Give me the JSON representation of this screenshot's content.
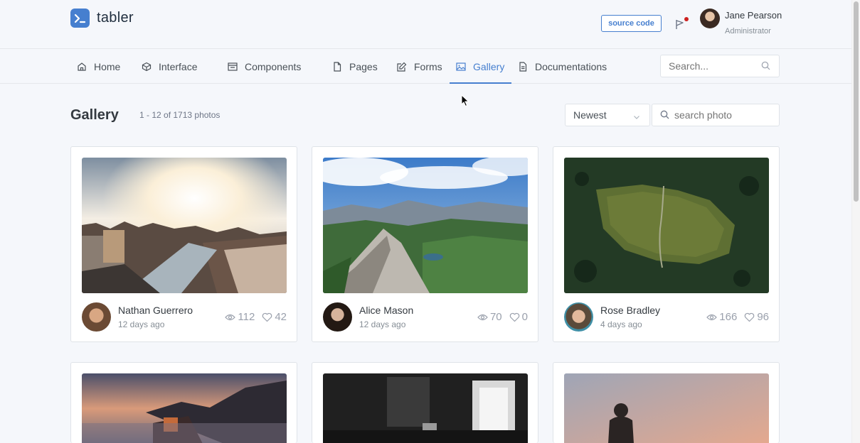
{
  "brand": {
    "name": "tabler"
  },
  "header": {
    "source_code_label": "source code",
    "user": {
      "name": "Jane Pearson",
      "role": "Administrator"
    }
  },
  "nav": {
    "items": [
      {
        "label": "Home",
        "icon": "home-icon"
      },
      {
        "label": "Interface",
        "icon": "box-icon"
      },
      {
        "label": "Components",
        "icon": "calendar-icon"
      },
      {
        "label": "Pages",
        "icon": "file-icon"
      },
      {
        "label": "Forms",
        "icon": "edit-icon"
      },
      {
        "label": "Gallery",
        "icon": "image-icon",
        "active": true
      },
      {
        "label": "Documentations",
        "icon": "file-text-icon"
      }
    ],
    "search_placeholder": "Search..."
  },
  "page": {
    "title": "Gallery",
    "subtitle": "1 - 12 of 1713 photos",
    "sort_value": "Newest",
    "search_placeholder": "search photo"
  },
  "colors": {
    "primary": "#467fcf",
    "danger": "#cd201f",
    "muted": "#9aa0ac"
  },
  "cards": [
    {
      "author": "Nathan Guerrero",
      "ago": "12 days ago",
      "views": "112",
      "likes": "42"
    },
    {
      "author": "Alice Mason",
      "ago": "12 days ago",
      "views": "70",
      "likes": "0"
    },
    {
      "author": "Rose Bradley",
      "ago": "4 days ago",
      "views": "166",
      "likes": "96"
    }
  ]
}
